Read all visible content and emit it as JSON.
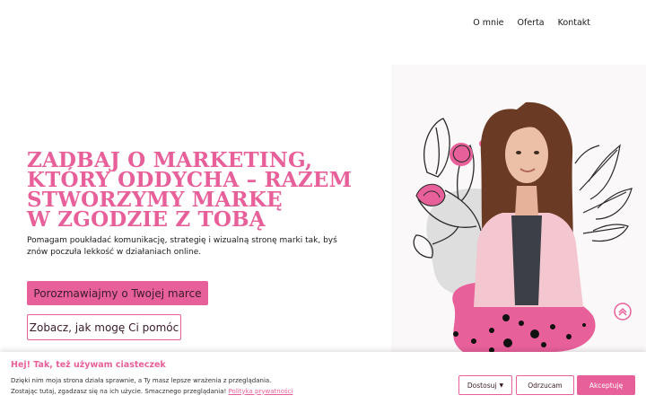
{
  "nav": {
    "items": [
      "O mnie",
      "Oferta",
      "Kontakt"
    ]
  },
  "hero": {
    "headline_lines": [
      "ZADBAJ O MARKETING,",
      "KTÓRY ODDYCHA – RAZEM",
      "STWORZYMY MARKĘ",
      "W ZGODZIE Z TOBĄ"
    ],
    "lead": "Pomagam poukładać komunikację, strategię i wizualną stronę marki tak, byś znów poczuła lekkość w działaniach online.",
    "cta_primary": "Porozmawiajmy o Twojej marce",
    "cta_secondary": "Zobacz, jak mogę Ci pomóc"
  },
  "cookie": {
    "title": "Hej! Tak, też używam ciasteczek",
    "line1": "Dzięki nim moja strona działa sprawnie, a Ty masz lepsze wrażenia z przeglądania.",
    "line2": "Zostając tutaj, zgadzasz się na ich użycie. Smacznego przeglądania!",
    "policy_link": "Polityka prywatności",
    "btn_customize": "Dostosuj",
    "btn_reject": "Odrzucam",
    "btn_accept": "Akceptuję"
  },
  "colors": {
    "accent": "#e8609a",
    "text": "#1a1a1a",
    "background": "#ffffff"
  },
  "icons": {
    "scroll_top": "chevron-up-circle-icon",
    "dropdown": "caret-down-icon"
  }
}
